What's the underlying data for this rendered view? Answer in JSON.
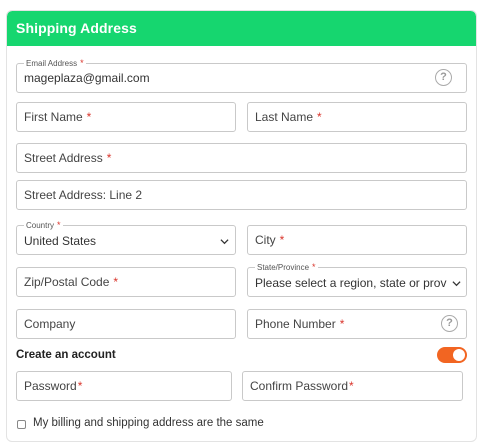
{
  "header": {
    "title": "Shipping Address"
  },
  "email": {
    "label": "Email Address",
    "required": "*",
    "value": "mageplaza@gmail.com",
    "help_icon": "question-circle-icon"
  },
  "first_name": {
    "placeholder": "First Name",
    "required": "*"
  },
  "last_name": {
    "placeholder": "Last Name",
    "required": "*"
  },
  "street": {
    "placeholder": "Street Address",
    "required": "*"
  },
  "street2": {
    "placeholder": "Street Address: Line 2"
  },
  "country": {
    "label": "Country",
    "required": "*",
    "value": "United States",
    "icon": "chevron-down-icon"
  },
  "city": {
    "placeholder": "City",
    "required": "*"
  },
  "zip": {
    "placeholder": "Zip/Postal Code",
    "required": "*"
  },
  "state": {
    "label": "State/Province",
    "required": "*",
    "value": "Please select a region, state or province",
    "icon": "chevron-down-icon"
  },
  "company": {
    "placeholder": "Company"
  },
  "phone": {
    "placeholder": "Phone Number",
    "required": "*",
    "help_icon": "question-circle-icon"
  },
  "create_account": {
    "label": "Create an account",
    "enabled": true
  },
  "password": {
    "placeholder": "Password",
    "required": "*"
  },
  "confirm_password": {
    "placeholder": "Confirm Password",
    "required": "*"
  },
  "same_address": {
    "label": "My billing and shipping address are the same",
    "checked": false
  },
  "help_glyph": "?",
  "colors": {
    "header": "#16d66f",
    "toggle": "#f26522",
    "required": "#d9342b"
  }
}
